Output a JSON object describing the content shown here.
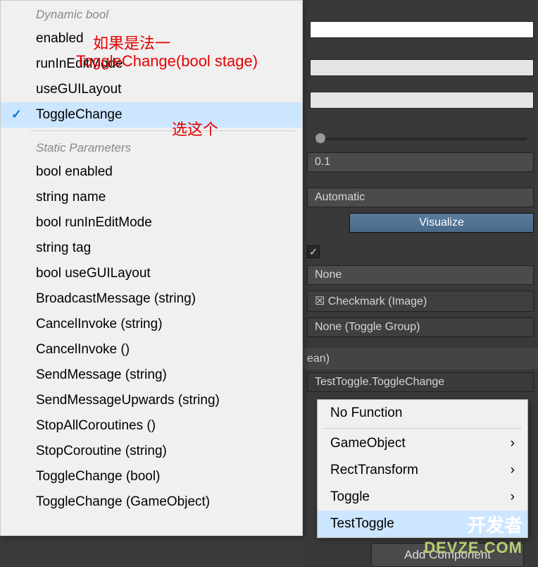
{
  "dropdown": {
    "section1_header": "Dynamic bool",
    "section1_items": [
      {
        "label": "enabled",
        "selected": false
      },
      {
        "label": "runInEditMode",
        "selected": false
      },
      {
        "label": "useGUILayout",
        "selected": false
      },
      {
        "label": "ToggleChange",
        "selected": true
      }
    ],
    "section2_header": "Static Parameters",
    "section2_items": [
      "bool enabled",
      "string name",
      "bool runInEditMode",
      "string tag",
      "bool useGUILayout",
      "BroadcastMessage (string)",
      "CancelInvoke (string)",
      "CancelInvoke ()",
      "SendMessage (string)",
      "SendMessageUpwards (string)",
      "StopAllCoroutines ()",
      "StopCoroutine (string)",
      "ToggleChange (bool)",
      "ToggleChange (GameObject)"
    ]
  },
  "annotations": {
    "line1": "如果是法一",
    "line2": "ToggleChange(bool stage)",
    "line3": "选这个"
  },
  "inspector": {
    "slider_value": "0.1",
    "nav_mode": "Automatic",
    "visualize_btn": "Visualize",
    "is_on_checked": true,
    "transition_target": "None",
    "graphic_value": "☒ Checkmark (Image)",
    "group_value": "None (Toggle Group)",
    "event_partial": "ean)",
    "event_method": "TestToggle.ToggleChange",
    "add_component": "Add Component"
  },
  "submenu": {
    "no_function": "No Function",
    "items": [
      {
        "label": "GameObject",
        "has_sub": true,
        "highlight": false
      },
      {
        "label": "RectTransform",
        "has_sub": true,
        "highlight": false
      },
      {
        "label": "Toggle",
        "has_sub": true,
        "highlight": false
      },
      {
        "label": "TestToggle",
        "has_sub": true,
        "highlight": true
      }
    ]
  },
  "watermark": {
    "cn": "开发者",
    "en": "DEVZE.COM"
  }
}
